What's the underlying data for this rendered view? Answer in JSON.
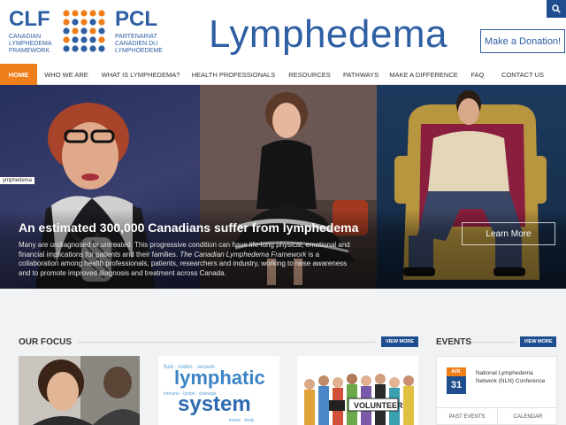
{
  "header": {
    "logo_left": "CLF",
    "logo_left_sub": "Canadian Lymphedema Framework",
    "logo_right": "PCL",
    "logo_right_sub": "Partenariat Canadien du Lymphoedeme",
    "title": "Lymphedema",
    "donate_label": "Make a Donation!",
    "search_icon": "search-icon"
  },
  "colors": {
    "brand_blue": "#2e5fa3",
    "dark_blue": "#1f4e8f",
    "accent_orange": "#ef7f1a"
  },
  "nav": {
    "items": [
      {
        "label": "HOME"
      },
      {
        "label": "WHO WE ARE"
      },
      {
        "label": "WHAT IS LYMPHEDEMA?"
      },
      {
        "label": "HEALTH PROFESSIONALS"
      },
      {
        "label": "RESOURCES"
      },
      {
        "label": "PATHWAYS"
      },
      {
        "label": "MAKE A DIFFERENCE"
      },
      {
        "label": "FAQ"
      },
      {
        "label": "CONTACT US"
      }
    ]
  },
  "hero": {
    "tab_label": "ymphedema",
    "heading": "An estimated 300,000 Canadians suffer from lymphedema",
    "text_1": "Many are undiagnosed or untreated. This progressive condition can have life-long physical, emotional and financial implications for patients and their families.",
    "text_italic": "The Canadian Lymphedema Framework",
    "text_2": "is a collaboration among health professionals, patients, researchers and industry, working to raise awareness and to promote improved diagnosis and treatment across Canada.",
    "learn_more_label": "Learn More"
  },
  "focus": {
    "title": "OUR FOCUS",
    "view_more_label": "VIEW MORE",
    "card2_words": "lymphatic system",
    "card3_label": "VOLUNTEER"
  },
  "events": {
    "title": "EVENTS",
    "view_more_label": "VIEW MORE",
    "item": {
      "month": "AVR.",
      "day": "31",
      "title": "National Lymphedema Network (NLN) Conference"
    },
    "tabs": [
      {
        "label": "PAST EVENTS"
      },
      {
        "label": "CALENDAR"
      }
    ]
  }
}
